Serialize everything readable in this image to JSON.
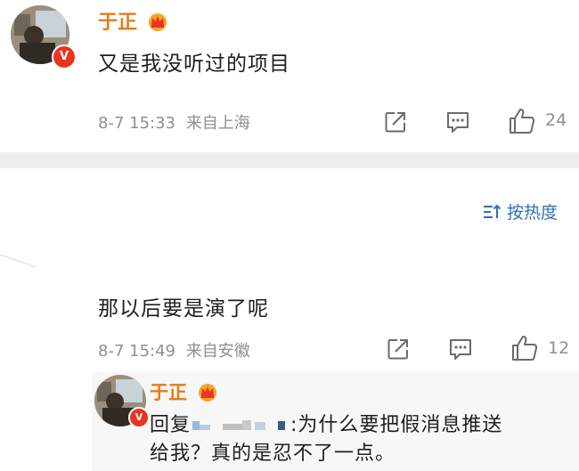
{
  "comment1": {
    "username": "于正",
    "text": "又是我没听过的项目",
    "date": "8-7 15:33",
    "location": "来自上海",
    "like_count": "24"
  },
  "sort_label": "按热度",
  "comment2": {
    "text": "那以后要是演了呢",
    "date": "8-7 15:49",
    "location": "来自安徽",
    "like_count": "12"
  },
  "reply": {
    "username": "于正",
    "prefix": "回复",
    "mention_suffix": ":为什么要把假消息推送",
    "line2": "给我？真的是忍不了一点。"
  },
  "icons": {
    "verified_badge": "verified-badge-icon",
    "crown": "crown-icon",
    "share": "share-icon",
    "comment": "comment-icon",
    "like": "thumbs-up-icon",
    "sort": "sort-icon"
  },
  "colors": {
    "username": "#ea7a10",
    "link": "#2f6fba",
    "verified": "#e8351f"
  }
}
